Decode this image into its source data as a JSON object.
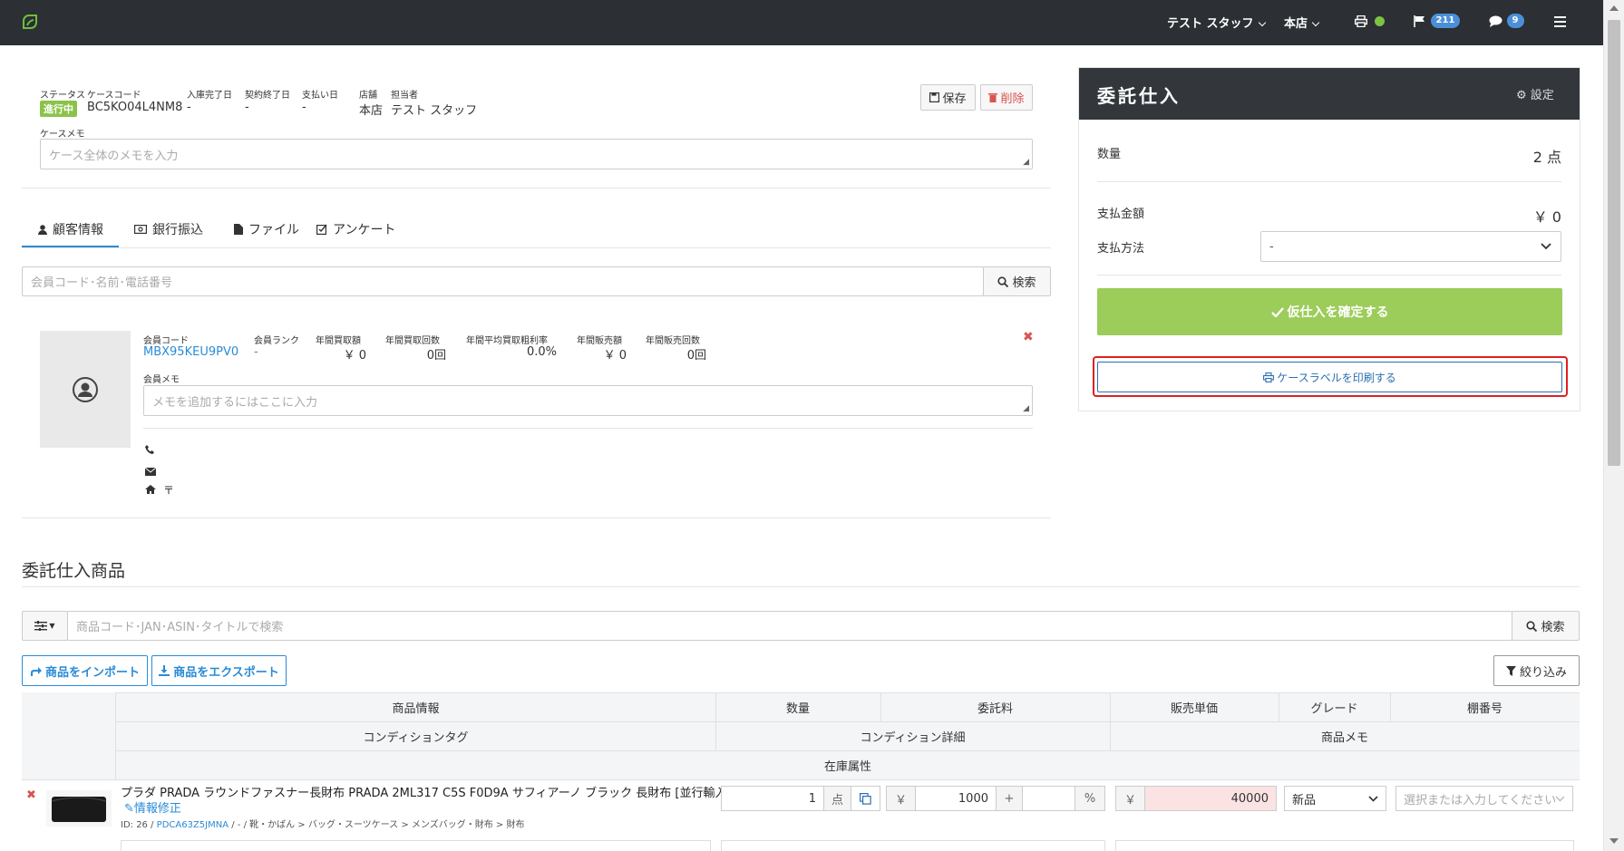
{
  "nav": {
    "staff": "テスト スタッフ",
    "store": "本店",
    "flag_count": "211",
    "chat_count": "9"
  },
  "case": {
    "labels": {
      "status": "ステータス",
      "case_code": "ケースコード",
      "received_date": "入庫完了日",
      "contract_end": "契約終了日",
      "payment_date": "支払い日",
      "store": "店舗",
      "staff": "担当者",
      "memo": "ケースメモ"
    },
    "status": "進行中",
    "case_code": "BC5KO04L4NM8",
    "received_date": "-",
    "contract_end": "-",
    "payment_date": "-",
    "store": "本店",
    "staff": "テスト スタッフ",
    "memo_placeholder": "ケース全体のメモを入力",
    "save_label": "保存",
    "delete_label": "削除"
  },
  "tabs": [
    "顧客情報",
    "銀行振込",
    "ファイル",
    "アンケート"
  ],
  "customer": {
    "search_placeholder": "会員コード･名前･電話番号",
    "search_label": "検索",
    "labels": {
      "member_code": "会員コード",
      "rank": "会員ランク",
      "annual_purchase_amount": "年間買取額",
      "annual_purchase_count": "年間買取回数",
      "annual_margin": "年間平均買取粗利率",
      "annual_sales_amount": "年間販売額",
      "annual_sales_count": "年間販売回数",
      "memo": "会員メモ"
    },
    "member_code": "MBX95KEU9PV0",
    "rank": "-",
    "annual_purchase_amount": "￥ 0",
    "annual_purchase_count": "0回",
    "annual_margin": "0.0%",
    "annual_sales_amount": "￥ 0",
    "annual_sales_count": "0回",
    "memo_placeholder": "メモを追加するにはここに入力",
    "address_mark": "〒"
  },
  "products": {
    "section_title": "委託仕入商品",
    "search_placeholder": "商品コード･JAN･ASIN･タイトルで検索",
    "search_label": "検索",
    "import_label": "商品をインポート",
    "export_label": "商品をエクスポート",
    "filter_label": "絞り込み",
    "headers": {
      "info": "商品情報",
      "quantity": "数量",
      "commission": "委託料",
      "unit_price": "販売単価",
      "grade": "グレード",
      "shelf": "棚番号",
      "condition_tag": "コンディションタグ",
      "condition_detail": "コンディション詳細",
      "product_memo": "商品メモ",
      "stock_attr": "在庫属性"
    },
    "rows": [
      {
        "title": "プラダ PRADA ラウンドファスナー長財布 PRADA 2ML317 C5S F0D9A サフィアーノ ブラック 長財布 [並行輸入品]",
        "edit_label": "情報修正",
        "id_prefix": "ID: 26 /",
        "code": "PDCA63Z5JMNA",
        "category": "/ - / 靴・かばん > バッグ・スーツケース > メンズバッグ・財布 > 財布",
        "quantity": "1",
        "quantity_unit": "点",
        "yen": "￥",
        "commission": "1000",
        "plus": "+",
        "percent": "%",
        "price": "40000",
        "grade": "新品",
        "shelf_placeholder": "選択または入力してください"
      }
    ]
  },
  "summary": {
    "title": "委託仕入",
    "settings_label": "設定",
    "quantity_label": "数量",
    "quantity_value": "2 点",
    "amount_label": "支払金額",
    "amount_value": "￥ 0",
    "method_label": "支払方法",
    "method_value": "-",
    "confirm_label": "仮仕入を確定する",
    "print_label": "ケースラベルを印刷する"
  },
  "colors": {
    "nav_bg": "#2c2f33",
    "status_green": "#8bc34a",
    "confirm_green": "#9ccc5a",
    "accent_blue": "#2a8bd6",
    "danger": "#d9534f",
    "highlight_border": "#e02020"
  }
}
